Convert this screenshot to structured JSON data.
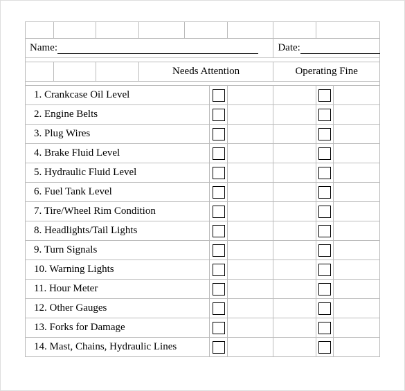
{
  "labels": {
    "name": "Name:",
    "date": "Date:",
    "needs_attention": "Needs Attention",
    "operating_fine": "Operating Fine"
  },
  "items": [
    "1. Crankcase Oil Level",
    "2. Engine Belts",
    "3. Plug Wires",
    "4. Brake Fluid Level",
    "5. Hydraulic Fluid Level",
    "6. Fuel Tank Level",
    "7. Tire/Wheel Rim Condition",
    "8. Headlights/Tail Lights",
    "9. Turn Signals",
    "10. Warning Lights",
    "11. Hour Meter",
    "12. Other Gauges",
    "13. Forks for Damage",
    "14. Mast, Chains, Hydraulic Lines"
  ]
}
